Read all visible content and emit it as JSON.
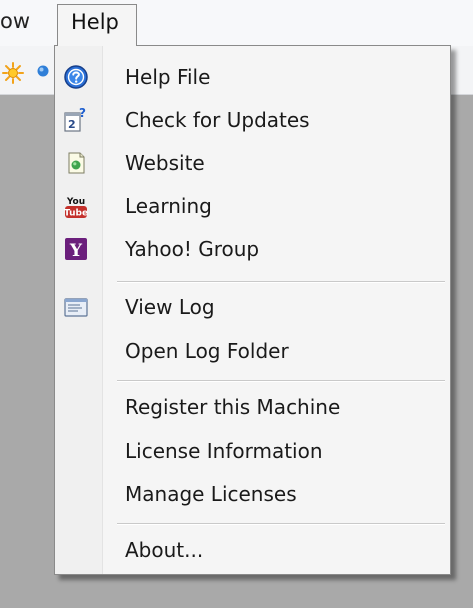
{
  "menubar": {
    "prev_item": "ow",
    "help": "Help"
  },
  "help_menu": {
    "items": [
      {
        "label": "Help File",
        "icon": "help-circle-icon"
      },
      {
        "label": "Check for Updates",
        "icon": "check-updates-icon"
      },
      {
        "label": "Website",
        "icon": "webpage-icon"
      },
      {
        "label": "Learning",
        "icon": "youtube-icon"
      },
      {
        "label": "Yahoo! Group",
        "icon": "yahoo-icon"
      },
      {
        "label": "View Log",
        "icon": "log-icon"
      },
      {
        "label": "Open Log Folder",
        "icon": ""
      },
      {
        "label": "Register this Machine",
        "icon": ""
      },
      {
        "label": "License Information",
        "icon": ""
      },
      {
        "label": "Manage Licenses",
        "icon": ""
      },
      {
        "label": "About...",
        "icon": ""
      }
    ],
    "youtube_icon_text": {
      "top": "You",
      "bottom": "Tube"
    },
    "yahoo_icon_text": "Y",
    "updates_icon_text": {
      "digit": "2",
      "mark": "?"
    }
  },
  "colors": {
    "youtube_red": "#c4302b",
    "yahoo_purple": "#6b1f7c",
    "help_blue": "#2a6fd6",
    "workspace_gray": "#a9a9a9"
  }
}
